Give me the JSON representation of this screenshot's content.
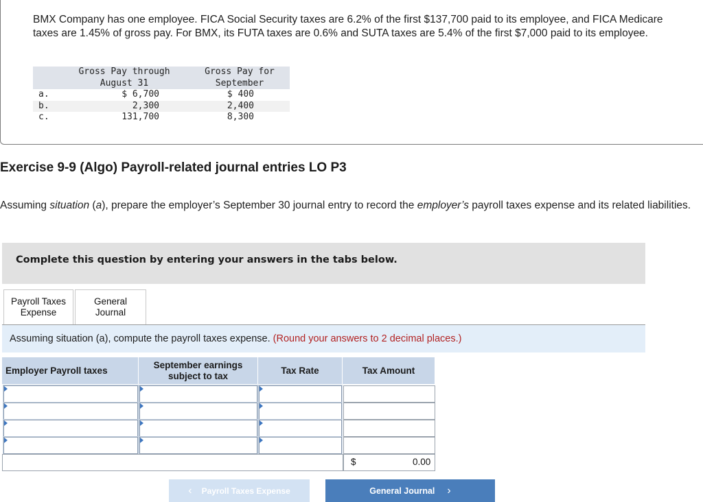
{
  "problem": {
    "text": "BMX Company has one employee. FICA Social Security taxes are 6.2% of the first $137,700 paid to its employee, and FICA Medicare taxes are 1.45% of gross pay. For BMX, its FUTA taxes are 0.6% and SUTA taxes are 5.4% of the first $7,000 paid to its employee.",
    "table": {
      "header_aug_1": "Gross Pay through",
      "header_aug_2": "August 31",
      "header_sep_1": "Gross Pay for",
      "header_sep_2": "September",
      "rows": [
        {
          "label": "a.",
          "aug": "$ 6,700",
          "sep": "$ 400"
        },
        {
          "label": "b.",
          "aug": "2,300",
          "sep": "2,400"
        },
        {
          "label": "c.",
          "aug": "131,700",
          "sep": "8,300"
        }
      ]
    }
  },
  "exercise_title": "Exercise 9-9 (Algo) Payroll-related journal entries LO P3",
  "instruction": {
    "part1": "Assuming ",
    "situation": "situation",
    "part2": " (",
    "a": "a",
    "part3": "), prepare the employer’s September 30 journal entry to record the ",
    "employers": "employer’s",
    "part4": " payroll taxes expense and its related liabilities."
  },
  "complete_banner": "Complete this question by entering your answers in the tabs below.",
  "tabs": [
    {
      "line1": "Payroll Taxes",
      "line2": "Expense"
    },
    {
      "line1": "General",
      "line2": "Journal"
    }
  ],
  "sub_instruction": {
    "text": "Assuming situation (a), compute the payroll taxes expense.",
    "note": "(Round your answers to 2 decimal places.)"
  },
  "payroll_table": {
    "headers": {
      "col1": "Employer Payroll taxes",
      "col2_1": "September earnings",
      "col2_2": "subject to tax",
      "col3": "Tax Rate",
      "col4": "Tax Amount"
    },
    "total_currency": "$",
    "total_value": "0.00"
  },
  "nav": {
    "prev_label": "Payroll Taxes Expense",
    "next_label": "General Journal"
  }
}
